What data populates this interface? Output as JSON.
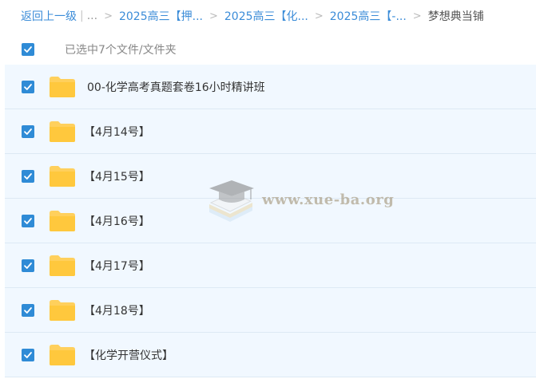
{
  "breadcrumb": {
    "back": "返回上一级",
    "sep": "|",
    "ellipsis": "...",
    "arrow": ">",
    "crumbs": [
      "2025高三【押...",
      "2025高三【化...",
      "2025高三【-..."
    ],
    "current": "梦想典当铺"
  },
  "selection": {
    "text": "已选中7个文件/文件夹"
  },
  "files": [
    {
      "name": "00-化学高考真题套卷16小时精讲班"
    },
    {
      "name": "【4月14号】"
    },
    {
      "name": "【4月15号】"
    },
    {
      "name": "【4月16号】"
    },
    {
      "name": "【4月17号】"
    },
    {
      "name": "【4月18号】"
    },
    {
      "name": "【化学开营仪式】"
    }
  ],
  "watermark": {
    "text": "www.xue-ba.org"
  },
  "colors": {
    "accent": "#2f8bd6",
    "link": "#3b8cd8",
    "folder": "#ffd05c",
    "row_bg": "#f1f8ff"
  },
  "icons": {
    "checkbox": "checkbox-checked-icon",
    "folder": "folder-icon"
  }
}
